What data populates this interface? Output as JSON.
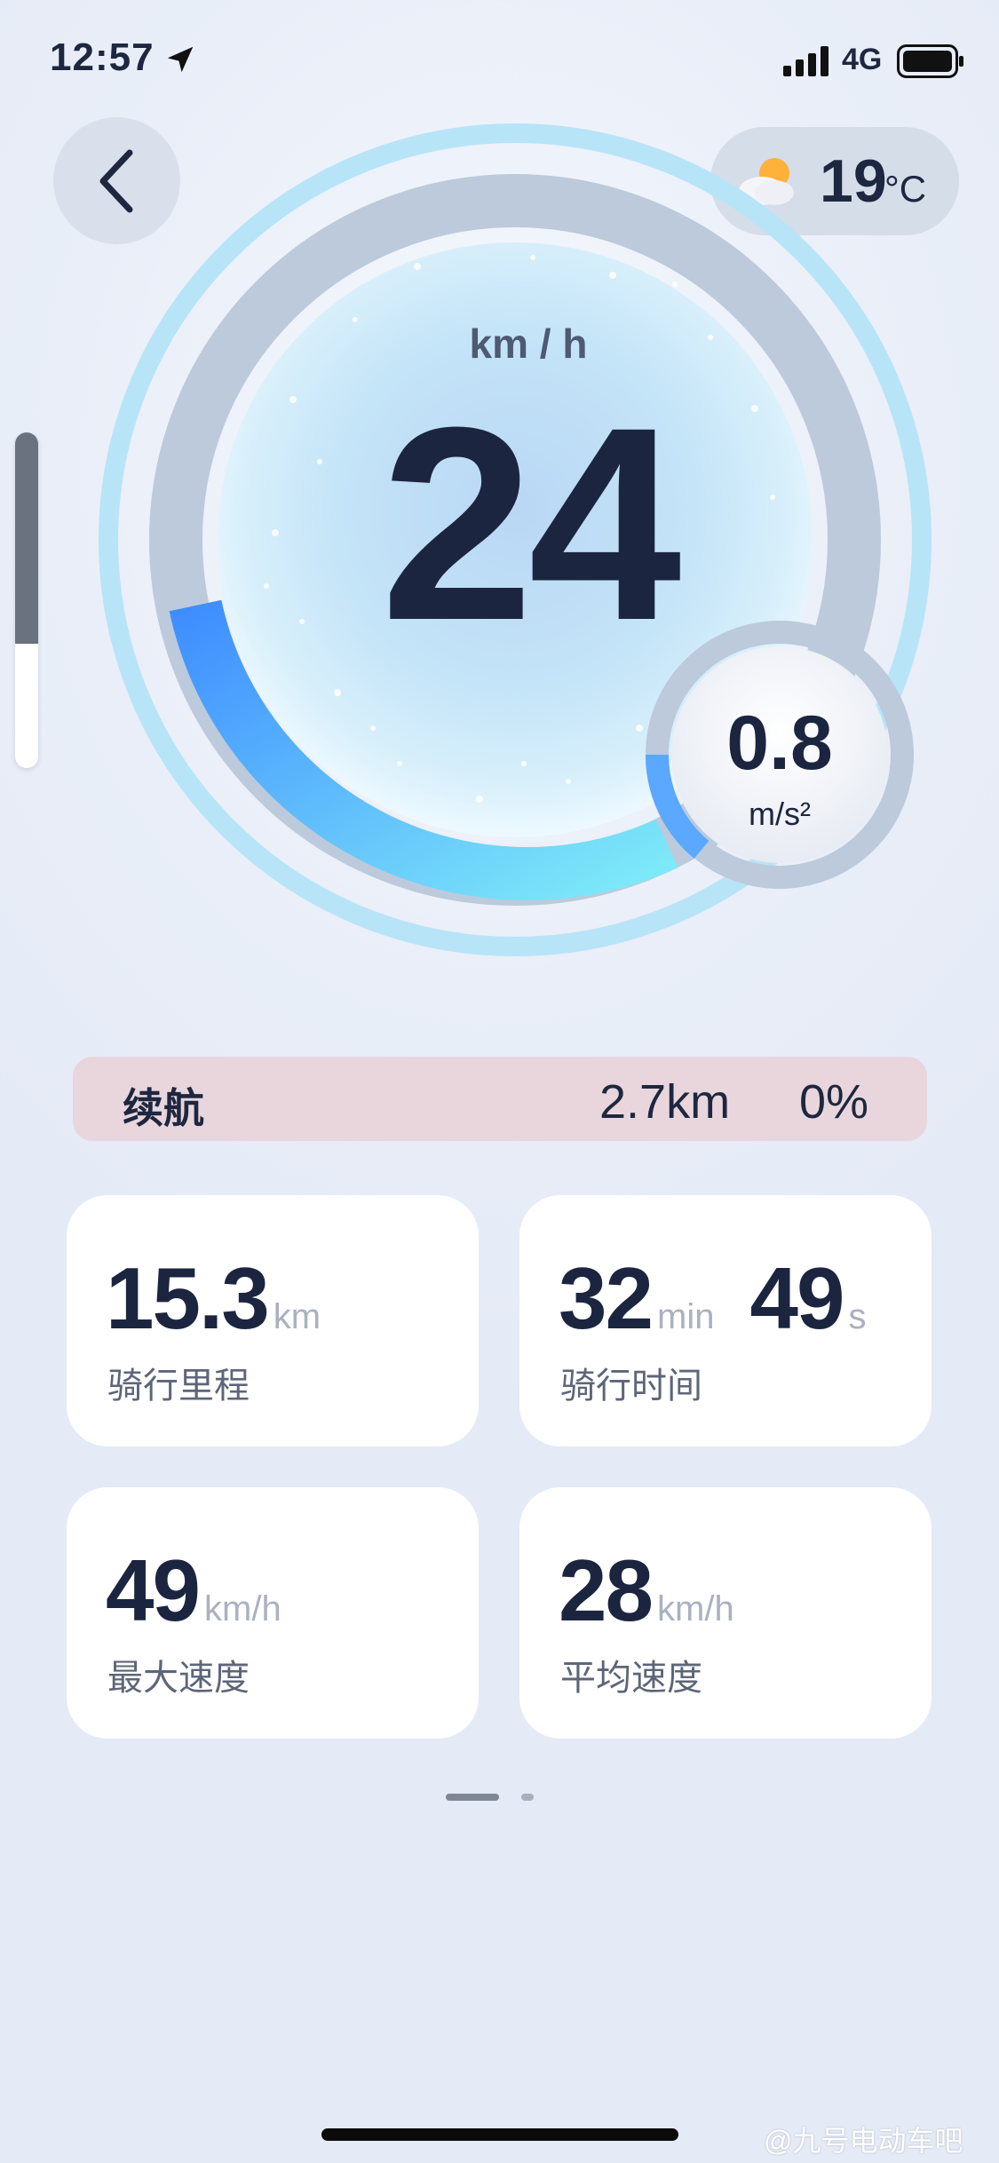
{
  "status_bar": {
    "time": "12:57",
    "network": "4G"
  },
  "weather": {
    "icon": "partly-cloudy-icon",
    "temperature": "19",
    "unit": "°C"
  },
  "speed": {
    "value": "24",
    "unit": "km / h"
  },
  "acceleration": {
    "value": "0.8",
    "unit": "m/s²"
  },
  "range": {
    "label": "续航",
    "distance": "2.7km",
    "percent": "0%"
  },
  "stats": [
    {
      "value": "15.3",
      "unit": "km",
      "label": "骑行里程"
    },
    {
      "value": "32",
      "unit": "min",
      "value2": "49",
      "unit2": "s",
      "label": "骑行时间"
    },
    {
      "value": "49",
      "unit": "km/h",
      "label": "最大速度"
    },
    {
      "value": "28",
      "unit": "km/h",
      "label": "平均速度"
    }
  ],
  "side_scrubber_level": 0.37,
  "pagination": {
    "current": 1,
    "total": 2
  },
  "watermark": "@九号电动车吧",
  "colors": {
    "accent_blue": "#3f9bff",
    "accent_cyan": "#7ee6f7",
    "range_bg": "#e8d6dc",
    "text_dark": "#1c2540"
  }
}
